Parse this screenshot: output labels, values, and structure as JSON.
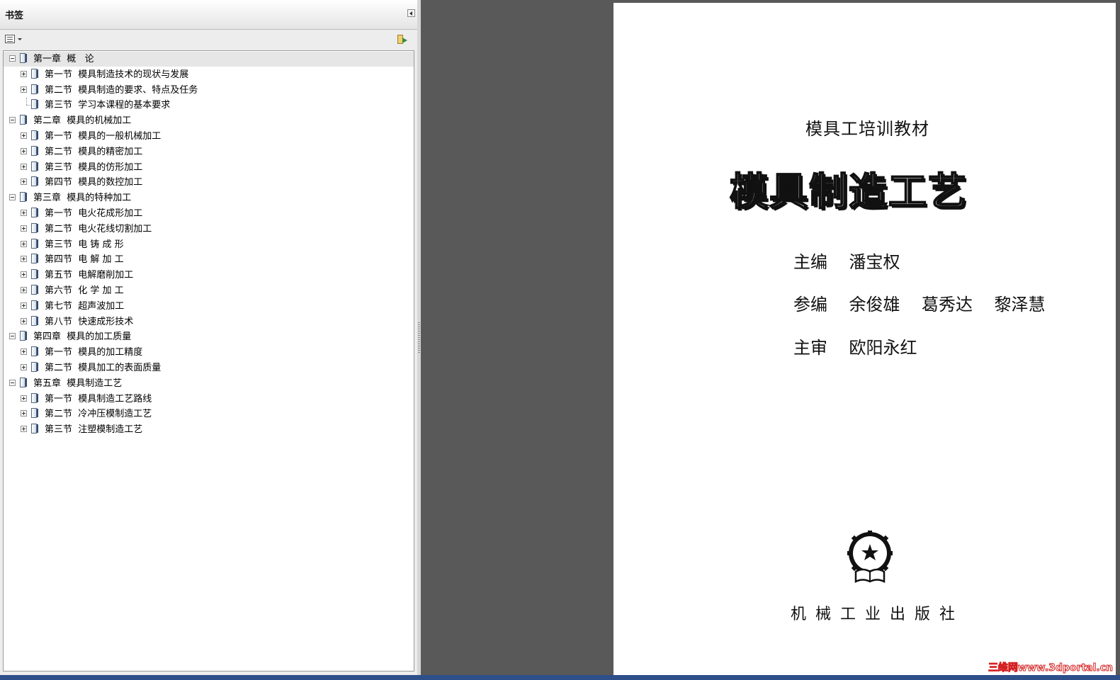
{
  "panel": {
    "title": "书签"
  },
  "bookmarks": [
    {
      "label": "第一章  概   论",
      "level": 0,
      "toggle": "minus"
    },
    {
      "label": "第一节  模具制造技术的现状与发展",
      "level": 1,
      "toggle": "plus"
    },
    {
      "label": "第二节  模具制造的要求、特点及任务",
      "level": 1,
      "toggle": "plus"
    },
    {
      "label": "第三节  学习本课程的基本要求",
      "level": 1,
      "toggle": "none"
    },
    {
      "label": "第二章  模具的机械加工",
      "level": 0,
      "toggle": "minus"
    },
    {
      "label": "第一节  模具的一般机械加工",
      "level": 1,
      "toggle": "plus"
    },
    {
      "label": "第二节  模具的精密加工",
      "level": 1,
      "toggle": "plus"
    },
    {
      "label": "第三节  模具的仿形加工",
      "level": 1,
      "toggle": "plus"
    },
    {
      "label": "第四节  模具的数控加工",
      "level": 1,
      "toggle": "plus"
    },
    {
      "label": "第三章  模具的特种加工",
      "level": 0,
      "toggle": "minus"
    },
    {
      "label": "第一节  电火花成形加工",
      "level": 1,
      "toggle": "plus"
    },
    {
      "label": "第二节  电火花线切割加工",
      "level": 1,
      "toggle": "plus"
    },
    {
      "label": "第三节  电 铸 成 形",
      "level": 1,
      "toggle": "plus"
    },
    {
      "label": "第四节  电 解 加 工",
      "level": 1,
      "toggle": "plus"
    },
    {
      "label": "第五节  电解磨削加工",
      "level": 1,
      "toggle": "plus"
    },
    {
      "label": "第六节  化 学 加 工",
      "level": 1,
      "toggle": "plus"
    },
    {
      "label": "第七节  超声波加工",
      "level": 1,
      "toggle": "plus"
    },
    {
      "label": "第八节  快速成形技术",
      "level": 1,
      "toggle": "plus"
    },
    {
      "label": "第四章  模具的加工质量",
      "level": 0,
      "toggle": "minus"
    },
    {
      "label": "第一节  模具的加工精度",
      "level": 1,
      "toggle": "plus"
    },
    {
      "label": "第二节  模具加工的表面质量",
      "level": 1,
      "toggle": "plus"
    },
    {
      "label": "第五章  模具制造工艺",
      "level": 0,
      "toggle": "minus"
    },
    {
      "label": "第一节  模具制造工艺路线",
      "level": 1,
      "toggle": "plus"
    },
    {
      "label": "第二节  冷冲压模制造工艺",
      "level": 1,
      "toggle": "plus"
    },
    {
      "label": "第三节  注塑模制造工艺",
      "level": 1,
      "toggle": "plus"
    }
  ],
  "document": {
    "subtitle": "模具工培训教材",
    "title": "模具制造工艺",
    "credits": [
      "主编    潘宝权",
      "参编    余俊雄    葛秀达    黎泽慧",
      "主审    欧阳永红"
    ],
    "publisher": "机械工业出版社"
  },
  "watermark": "三维网www.3dportal.cn",
  "colors": {
    "workspace": "#595959",
    "panel": "#ededed",
    "taskbar": "#2e4f8a",
    "watermark": "#d42020"
  }
}
